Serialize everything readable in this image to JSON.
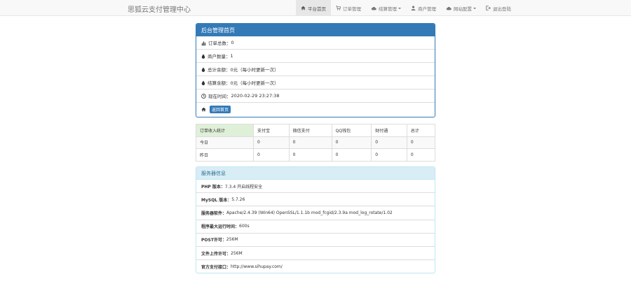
{
  "navbar": {
    "brand": "思狐云支付管理中心",
    "items": [
      {
        "label": "平台首页",
        "icon": "home-icon",
        "dropdown": false,
        "active": true
      },
      {
        "label": "订单管理",
        "icon": "cart-icon",
        "dropdown": false,
        "active": false
      },
      {
        "label": "结算管理",
        "icon": "cloud-icon",
        "dropdown": true,
        "active": false
      },
      {
        "label": "商户管理",
        "icon": "user-icon",
        "dropdown": false,
        "active": false
      },
      {
        "label": "网站配置",
        "icon": "cloud-icon",
        "dropdown": true,
        "active": false
      },
      {
        "label": "退出登陆",
        "icon": "logout-icon",
        "dropdown": false,
        "active": false
      }
    ]
  },
  "summary": {
    "title": "后台管理首页",
    "rows": [
      {
        "icon": "bar-chart-icon",
        "label": "订单总数：",
        "value": "0"
      },
      {
        "icon": "tint-icon",
        "label": "商户数量：",
        "value": "1"
      },
      {
        "icon": "tint-icon",
        "label": "总计余额：",
        "value": "0元（每小时更新一次）"
      },
      {
        "icon": "tint-icon",
        "label": "结算余额：",
        "value": "0元（每小时更新一次）"
      },
      {
        "icon": "clock-icon",
        "label": "现在时间：",
        "value": "2020-02-29 23:27:38"
      }
    ],
    "home_link": "返回首页"
  },
  "stats_table": {
    "headers": [
      "订单收入统计",
      "支付宝",
      "微信支付",
      "QQ钱包",
      "财付通",
      "总计"
    ],
    "rows": [
      [
        "今日",
        "0",
        "0",
        "0",
        "0",
        "0"
      ],
      [
        "昨日",
        "0",
        "0",
        "0",
        "0",
        "0"
      ]
    ]
  },
  "server": {
    "title": "服务器信息",
    "rows": [
      {
        "label": "PHP 版本：",
        "value": "7.3.4 开启线程安全"
      },
      {
        "label": "MySQL 版本：",
        "value": "5.7.26"
      },
      {
        "label": "服务器软件：",
        "value": "Apache/2.4.39 (Win64) OpenSSL/1.1.1b mod_fcgid/2.3.9a mod_log_rotate/1.02"
      },
      {
        "label": "程序最大运行时间：",
        "value": "600s"
      },
      {
        "label": "POST许可：",
        "value": "256M"
      },
      {
        "label": "文件上传许可：",
        "value": "256M"
      },
      {
        "label": "官方支付接口：",
        "value": "http://www.sihupay.com/"
      }
    ]
  },
  "colors": {
    "primary": "#337ab7",
    "info_bg": "#d9edf7",
    "success_bg": "#dff0d8"
  }
}
